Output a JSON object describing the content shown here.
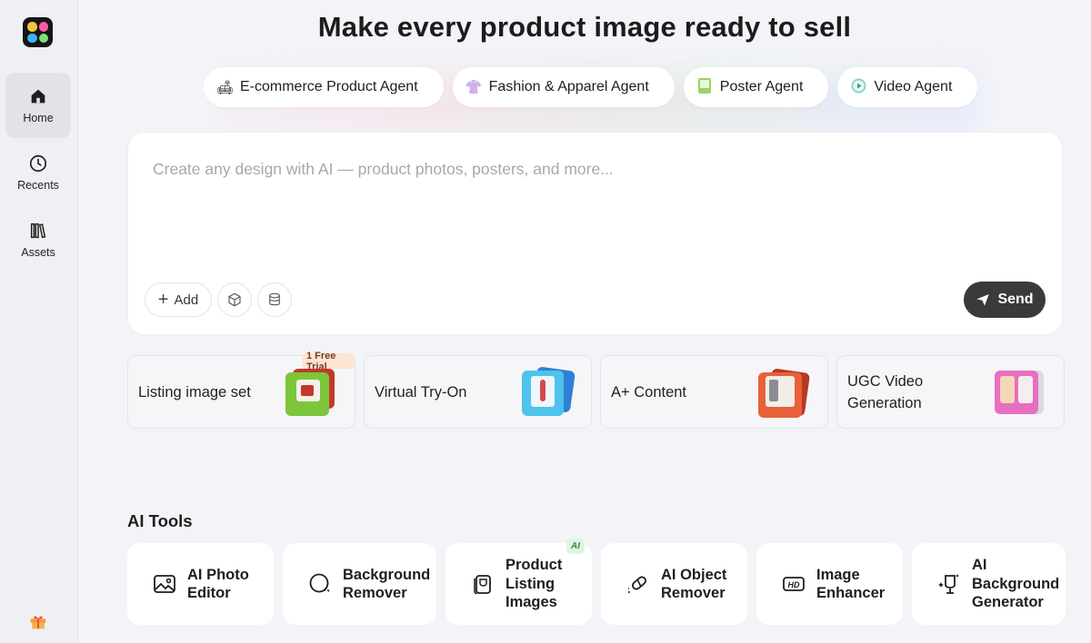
{
  "sidebar": {
    "items": [
      {
        "label": "Home",
        "icon": "home-icon"
      },
      {
        "label": "Recents",
        "icon": "clock-icon"
      },
      {
        "label": "Assets",
        "icon": "library-icon"
      }
    ],
    "gift_icon": "gift-icon"
  },
  "headline": "Make every product image ready to sell",
  "agents": [
    {
      "label": "E-commerce Product Agent",
      "icon": "sofa-icon"
    },
    {
      "label": "Fashion & Apparel Agent",
      "icon": "shirt-icon"
    },
    {
      "label": "Poster Agent",
      "icon": "poster-icon"
    },
    {
      "label": "Video Agent",
      "icon": "video-icon"
    }
  ],
  "prompt": {
    "placeholder": "Create any design with AI — product photos, posters, and more...",
    "add_label": "Add",
    "send_label": "Send"
  },
  "features": [
    {
      "label": "Listing image set",
      "badge": "1 Free Trial"
    },
    {
      "label": "Virtual Try-On"
    },
    {
      "label": "A+ Content"
    },
    {
      "label": "UGC Video Generation"
    }
  ],
  "ai_tools": {
    "title": "AI Tools",
    "items": [
      {
        "label": "AI Photo Editor",
        "icon": "photo-edit-icon"
      },
      {
        "label": "Background Remover",
        "icon": "bg-remove-icon"
      },
      {
        "label": "Product Listing Images",
        "icon": "listing-icon",
        "badge": "AI"
      },
      {
        "label": "AI Object Remover",
        "icon": "eraser-icon"
      },
      {
        "label": "Image Enhancer",
        "icon": "hd-icon"
      },
      {
        "label": "AI Background Generator",
        "icon": "bg-generate-icon"
      }
    ]
  },
  "colors": {
    "send_bg": "#3a3a3a",
    "trial_bg": "#fde4d4",
    "ai_badge_bg": "#dff3e3"
  }
}
